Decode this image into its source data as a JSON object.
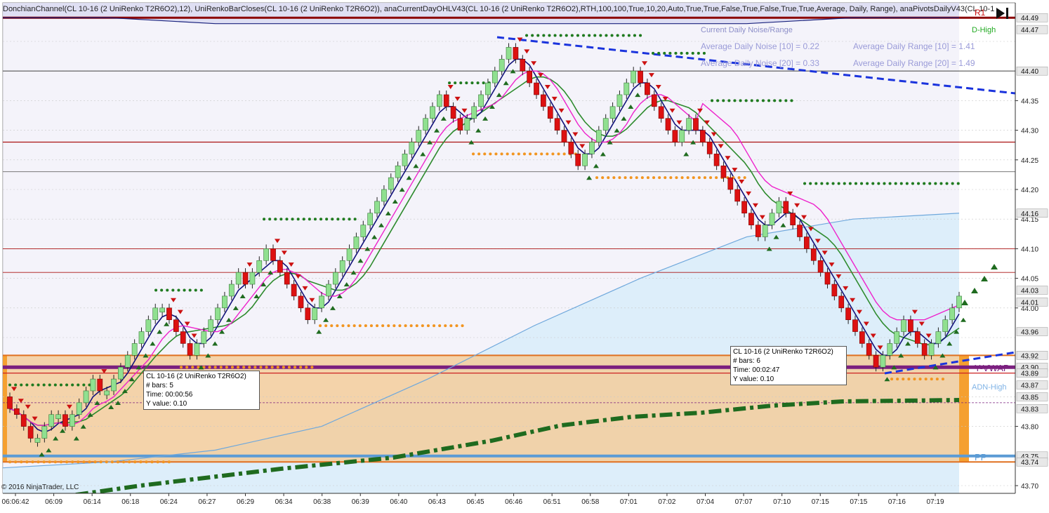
{
  "header": {
    "indicators_text": "DonchianChannel(CL 10-16 (2 UniRenko T2R6O2),12), UniRenkoBarCloses(CL 10-16 (2 UniRenko T2R6O2)), anaCurrentDayOHLV43(CL 10-16 (2 UniRenko T2R6O2),RTH,100,100,True,10,20,Auto,True,True,False,True,False,True,True,Average, Daily, Range), anaPivotsDailyV43(CL 10-1"
  },
  "info_panel": {
    "line1_left": "Current Daily Noise/Range",
    "line1_right": "D-High",
    "line2_left": "Average Daily Noise [10] = 0.22",
    "line2_right": "Average Daily Range [10] = 1.41",
    "line3_left": "Average Daily Noise [20] = 0.33",
    "line3_right": "Average Daily Range [20] = 1.49"
  },
  "level_labels": {
    "r1": "R1",
    "d_high": "D-High",
    "y_vwap": "Y-VWAP",
    "adn_high": "ADN-High",
    "pp": "PP"
  },
  "tooltips": [
    {
      "title": "CL 10-16 (2 UniRenko T2R6O2)",
      "bars": "# bars:   5",
      "time": "Time:     00:00:56",
      "yval": "Y value:  0.10"
    },
    {
      "title": "CL 10-16 (2 UniRenko T2R6O2)",
      "bars": "# bars:   6",
      "time": "Time:     00:02:47",
      "yval": "Y value:  0.10"
    }
  ],
  "copyright": "© 2016 NinjaTrader, LLC",
  "colors": {
    "up_candle": "#90e090",
    "down_candle": "#dd1111",
    "donchian_upper_fill": "#dcdcf2",
    "donchian_lower_fill": "#ddeefa",
    "donchian_upper_line": "#1a237e",
    "donchian_lower_line": "#6fa8dc",
    "navy_ma": "#12127a",
    "green_ma": "#2e8b2e",
    "magenta_ma": "#ee22cc",
    "pivot_band": "#f3cc9b",
    "vwap": "#7b1f7f",
    "pp_line": "#5b9bd5",
    "dashed_green": "#1f6b1f",
    "trend_blue": "#1a33dd",
    "highlight_price": "#ff8800",
    "axis_tag": "#e8e8e8"
  },
  "chart_data": {
    "type": "candlestick",
    "instrument": "CL 10-16 (2 UniRenko T2R6O2)",
    "y_axis": {
      "range": [
        43.7,
        44.49
      ],
      "ticks": [
        43.7,
        43.75,
        43.8,
        43.85,
        43.9,
        43.95,
        44.0,
        44.05,
        44.1,
        44.15,
        44.2,
        44.25,
        44.3,
        44.35,
        44.4,
        44.45
      ],
      "tick_labels": [
        "43.70",
        "43.80",
        "44.00",
        "44.05",
        "44.10",
        "44.15",
        "44.20",
        "44.25",
        "44.30",
        "44.35"
      ],
      "highlighted_labels": [
        {
          "label": "44.49",
          "value": 44.49
        },
        {
          "label": "44.47",
          "value": 44.47
        },
        {
          "label": "44.40",
          "value": 44.4
        },
        {
          "label": "44.16",
          "value": 44.16
        },
        {
          "label": "44.03",
          "value": 44.03
        },
        {
          "label": "44.01",
          "value": 44.01
        },
        {
          "label": "43.96",
          "value": 43.96
        },
        {
          "label": "43.92",
          "value": 43.92
        },
        {
          "label": "43.90",
          "value": 43.9
        },
        {
          "label": "43.89",
          "value": 43.89
        },
        {
          "label": "43.87",
          "value": 43.87
        },
        {
          "label": "43.85",
          "value": 43.85
        },
        {
          "label": "43.83",
          "value": 43.83
        },
        {
          "label": "43.75",
          "value": 43.75
        },
        {
          "label": "43.74",
          "value": 43.74
        }
      ]
    },
    "x_axis": {
      "tick_labels": [
        "06:06:42",
        "06:09",
        "06:14",
        "06:18",
        "06:24",
        "06:27",
        "06:29",
        "06:34",
        "06:38",
        "06:39",
        "06:40",
        "06:43",
        "06:45",
        "06:46",
        "06:51",
        "06:58",
        "07:01",
        "07:02",
        "07:04",
        "07:07",
        "07:10",
        "07:15",
        "07:15",
        "07:16",
        "07:19"
      ]
    },
    "bars_close": [
      43.83,
      43.82,
      43.8,
      43.78,
      43.78,
      43.8,
      43.82,
      43.82,
      43.8,
      43.82,
      43.84,
      43.86,
      43.88,
      43.86,
      43.86,
      43.88,
      43.9,
      43.92,
      43.94,
      43.96,
      43.98,
      44.0,
      44.0,
      43.98,
      43.96,
      43.94,
      43.92,
      43.94,
      43.96,
      43.98,
      44.0,
      44.02,
      44.04,
      44.06,
      44.04,
      44.06,
      44.08,
      44.1,
      44.08,
      44.06,
      44.04,
      44.02,
      44.0,
      43.98,
      44.0,
      44.02,
      44.04,
      44.06,
      44.08,
      44.1,
      44.12,
      44.14,
      44.16,
      44.18,
      44.2,
      44.22,
      44.24,
      44.26,
      44.28,
      44.3,
      44.32,
      44.34,
      44.36,
      44.34,
      44.32,
      44.3,
      44.32,
      44.34,
      44.36,
      44.38,
      44.4,
      44.42,
      44.44,
      44.42,
      44.4,
      44.38,
      44.36,
      44.34,
      44.32,
      44.3,
      44.28,
      44.26,
      44.24,
      44.26,
      44.28,
      44.3,
      44.32,
      44.34,
      44.36,
      44.38,
      44.4,
      44.38,
      44.36,
      44.34,
      44.32,
      44.3,
      44.28,
      44.3,
      44.32,
      44.3,
      44.28,
      44.26,
      44.24,
      44.22,
      44.2,
      44.18,
      44.16,
      44.14,
      44.12,
      44.14,
      44.16,
      44.18,
      44.16,
      44.14,
      44.12,
      44.1,
      44.08,
      44.06,
      44.04,
      44.02,
      44.0,
      43.98,
      43.96,
      43.94,
      43.92,
      43.9,
      43.92,
      43.94,
      43.96,
      43.98,
      43.96,
      43.94,
      43.92,
      43.94,
      43.96,
      43.98,
      44.0,
      44.02
    ],
    "series": [
      {
        "name": "DonchianChannel upper",
        "values": [
          44.49,
          44.49,
          44.48,
          44.48,
          44.48,
          44.48,
          44.48,
          44.48,
          44.49,
          44.49
        ]
      },
      {
        "name": "DonchianChannel lower",
        "values": [
          43.73,
          43.74,
          43.76,
          43.8,
          43.88,
          43.97,
          44.05,
          44.12,
          44.15,
          44.16
        ]
      }
    ],
    "levels": [
      {
        "name": "R1",
        "value": 44.49
      },
      {
        "name": "D-High",
        "value": 44.47
      },
      {
        "name": "Y-VWAP",
        "value": 43.9
      },
      {
        "name": "ADN-High",
        "value": 43.87
      },
      {
        "name": "PP",
        "value": 43.75
      }
    ],
    "grid": true
  }
}
